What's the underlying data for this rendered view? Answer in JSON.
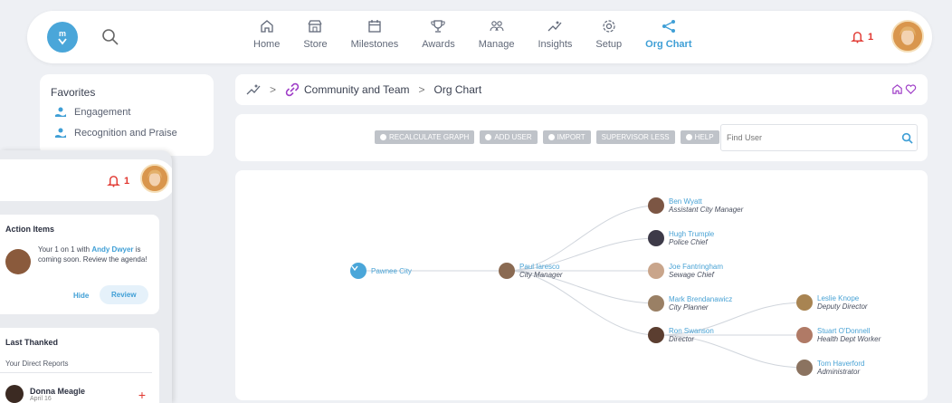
{
  "nav": {
    "items": [
      {
        "label": "Home",
        "icon": "home-icon"
      },
      {
        "label": "Store",
        "icon": "store-icon"
      },
      {
        "label": "Milestones",
        "icon": "calendar-icon"
      },
      {
        "label": "Awards",
        "icon": "trophy-icon"
      },
      {
        "label": "Manage",
        "icon": "people-icon"
      },
      {
        "label": "Insights",
        "icon": "insights-icon"
      },
      {
        "label": "Setup",
        "icon": "gear-icon"
      },
      {
        "label": "Org Chart",
        "icon": "share-icon",
        "active": true
      }
    ],
    "notification_count": "1"
  },
  "favorites": {
    "title": "Favorites",
    "items": [
      {
        "label": "Engagement"
      },
      {
        "label": "Recognition and Praise"
      }
    ]
  },
  "breadcrumb": {
    "section": "Community and Team",
    "separator": ">",
    "page": "Org Chart"
  },
  "toolbar": {
    "buttons": [
      "RECALCULATE GRAPH",
      "ADD USER",
      "IMPORT",
      "SUPERVISOR LESS",
      "HELP"
    ],
    "find_placeholder": "Find User"
  },
  "org": {
    "root": {
      "name": "Pawnee City"
    },
    "nodes": [
      {
        "name": "Paul Iaresco",
        "title": "City Manager"
      },
      {
        "name": "Ben Wyatt",
        "title": "Assistant City Manager"
      },
      {
        "name": "Hugh Trumple",
        "title": "Police Chief"
      },
      {
        "name": "Joe Fantringham",
        "title": "Sewage Chief"
      },
      {
        "name": "Mark Brendanawicz",
        "title": "City Planner"
      },
      {
        "name": "Ron Swanson",
        "title": "Director"
      },
      {
        "name": "Leslie Knope",
        "title": "Deputy Director"
      },
      {
        "name": "Stuart O'Donnell",
        "title": "Health Dept Worker"
      },
      {
        "name": "Tom Haverford",
        "title": "Administrator"
      }
    ]
  },
  "side_panel": {
    "notification_count": "1",
    "action_items": {
      "title": "Action Items",
      "text_before": "Your 1 on 1 with ",
      "person": "Andy Dwyer",
      "text_after": " is coming soon. Review the agenda!",
      "hide_label": "Hide",
      "review_label": "Review"
    },
    "last_thanked": {
      "title": "Last Thanked",
      "subtitle": "Your Direct Reports",
      "reports": [
        {
          "name": "Donna Meagle",
          "date": "April 16"
        }
      ]
    }
  },
  "colors": {
    "accent": "#3f9fd6",
    "alert": "#e1362f",
    "button_grey": "#bfc3c9"
  }
}
